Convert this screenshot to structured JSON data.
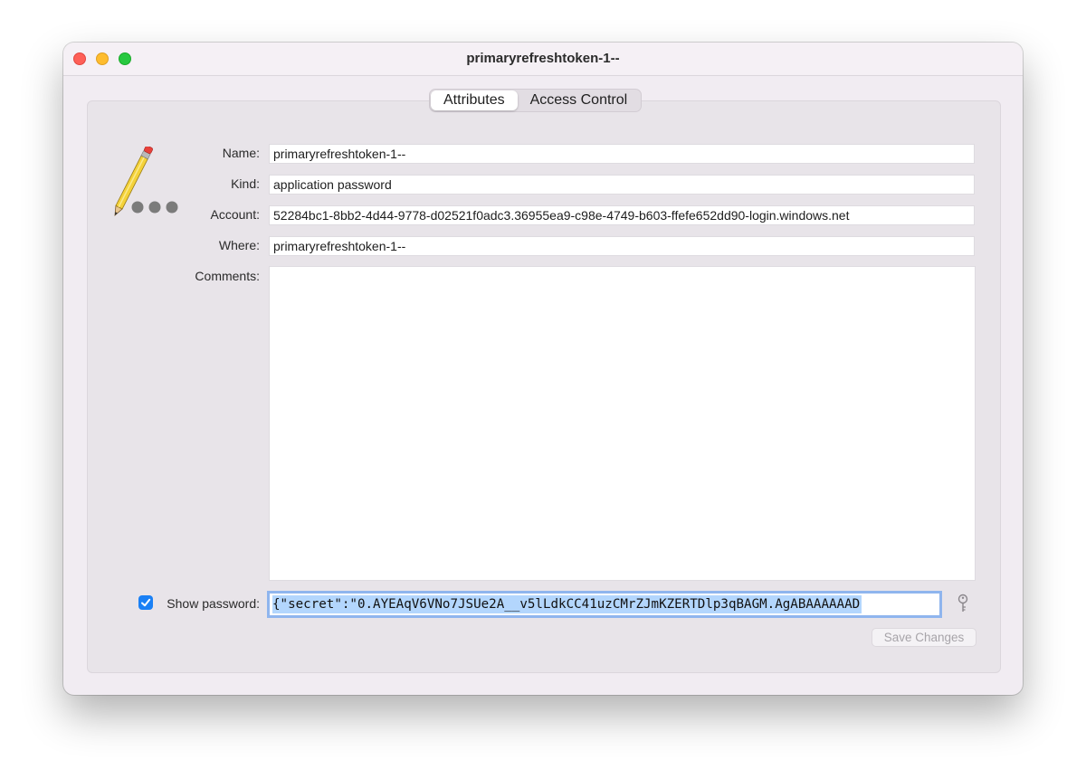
{
  "window": {
    "title": "primaryrefreshtoken-1--"
  },
  "tabs": [
    {
      "label": "Attributes",
      "selected": true
    },
    {
      "label": "Access Control",
      "selected": false
    }
  ],
  "fields": {
    "name": {
      "label": "Name:",
      "value": "primaryrefreshtoken-1--"
    },
    "kind": {
      "label": "Kind:",
      "value": "application password"
    },
    "account": {
      "label": "Account:",
      "value": "52284bc1-8bb2-4d44-9778-d02521f0adc3.36955ea9-c98e-4749-b603-ffefe652dd90-login.windows.net"
    },
    "where": {
      "label": "Where:",
      "value": "primaryrefreshtoken-1--"
    },
    "comments": {
      "label": "Comments:",
      "value": ""
    }
  },
  "password": {
    "checkbox_label": "Show password:",
    "checked": true,
    "value": "{\"secret\":\"0.AYEAqV6VNo7JSUe2A__v5lLdkCC41uzCMrZJmKZERTDlp3qBAGM.AgABAAAAAAD"
  },
  "buttons": {
    "save_label": "Save Changes"
  },
  "icons": {
    "app_icon": "pencil-icon",
    "password_assistant": "key-icon"
  },
  "colors": {
    "accent": "#1a80f5",
    "selection": "#b3d6fd",
    "close": "#fe5f57",
    "minimize": "#febc2e",
    "maximize": "#28c840"
  }
}
